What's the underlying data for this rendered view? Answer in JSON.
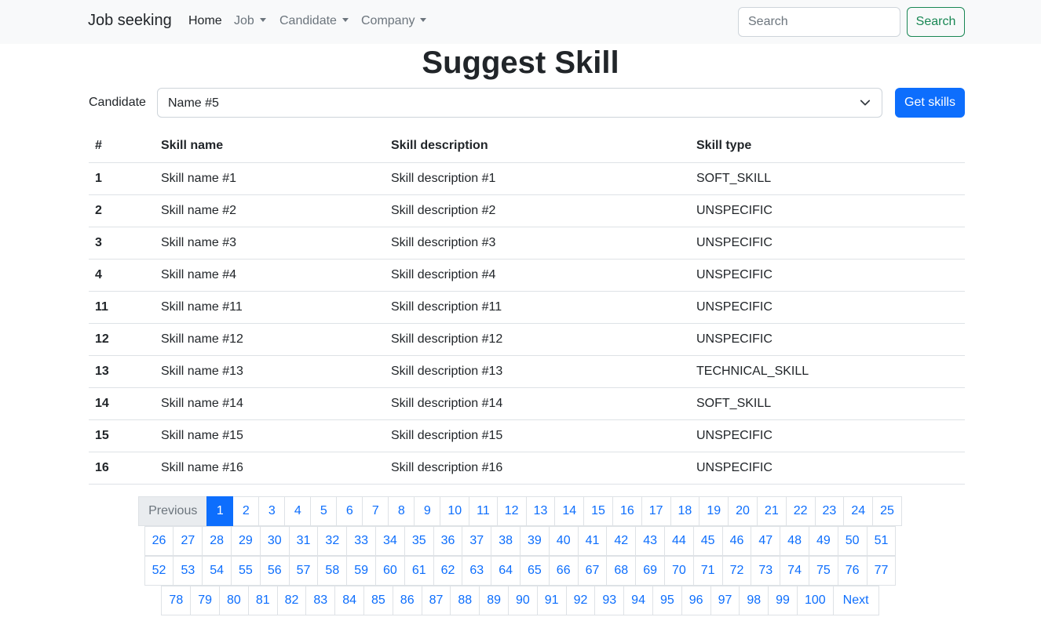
{
  "navbar": {
    "brand": "Job seeking",
    "items": [
      {
        "label": "Home",
        "dropdown": false
      },
      {
        "label": "Job",
        "dropdown": true
      },
      {
        "label": "Candidate",
        "dropdown": true
      },
      {
        "label": "Company",
        "dropdown": true
      }
    ],
    "search_placeholder": "Search",
    "search_button": "Search"
  },
  "title": "Suggest Skill",
  "candidate": {
    "label": "Candidate",
    "selected": "Name #5",
    "button": "Get skills"
  },
  "table": {
    "headers": [
      "#",
      "Skill name",
      "Skill description",
      "Skill type"
    ],
    "rows": [
      [
        "1",
        "Skill name #1",
        "Skill description #1",
        "SOFT_SKILL"
      ],
      [
        "2",
        "Skill name #2",
        "Skill description #2",
        "UNSPECIFIC"
      ],
      [
        "3",
        "Skill name #3",
        "Skill description #3",
        "UNSPECIFIC"
      ],
      [
        "4",
        "Skill name #4",
        "Skill description #4",
        "UNSPECIFIC"
      ],
      [
        "11",
        "Skill name #11",
        "Skill description #11",
        "UNSPECIFIC"
      ],
      [
        "12",
        "Skill name #12",
        "Skill description #12",
        "UNSPECIFIC"
      ],
      [
        "13",
        "Skill name #13",
        "Skill description #13",
        "TECHNICAL_SKILL"
      ],
      [
        "14",
        "Skill name #14",
        "Skill description #14",
        "SOFT_SKILL"
      ],
      [
        "15",
        "Skill name #15",
        "Skill description #15",
        "UNSPECIFIC"
      ],
      [
        "16",
        "Skill name #16",
        "Skill description #16",
        "UNSPECIFIC"
      ]
    ]
  },
  "pagination": {
    "previous": "Previous",
    "next": "Next",
    "current": "1",
    "pages": [
      "1",
      "2",
      "3",
      "4",
      "5",
      "6",
      "7",
      "8",
      "9",
      "10",
      "11",
      "12",
      "13",
      "14",
      "15",
      "16",
      "17",
      "18",
      "19",
      "20",
      "21",
      "22",
      "23",
      "24",
      "25",
      "26",
      "27",
      "28",
      "29",
      "30",
      "31",
      "32",
      "33",
      "34",
      "35",
      "36",
      "37",
      "38",
      "39",
      "40",
      "41",
      "42",
      "43",
      "44",
      "45",
      "46",
      "47",
      "48",
      "49",
      "50",
      "51",
      "52",
      "53",
      "54",
      "55",
      "56",
      "57",
      "58",
      "59",
      "60",
      "61",
      "62",
      "63",
      "64",
      "65",
      "66",
      "67",
      "68",
      "69",
      "70",
      "71",
      "72",
      "73",
      "74",
      "75",
      "76",
      "77",
      "78",
      "79",
      "80",
      "81",
      "82",
      "83",
      "84",
      "85",
      "86",
      "87",
      "88",
      "89",
      "90",
      "91",
      "92",
      "93",
      "94",
      "95",
      "96",
      "97",
      "98",
      "99",
      "100"
    ]
  },
  "colors": {
    "primary": "#0d6efd",
    "success": "#198754",
    "navbar_bg": "#f8f9fa",
    "border": "#dee2e6"
  }
}
